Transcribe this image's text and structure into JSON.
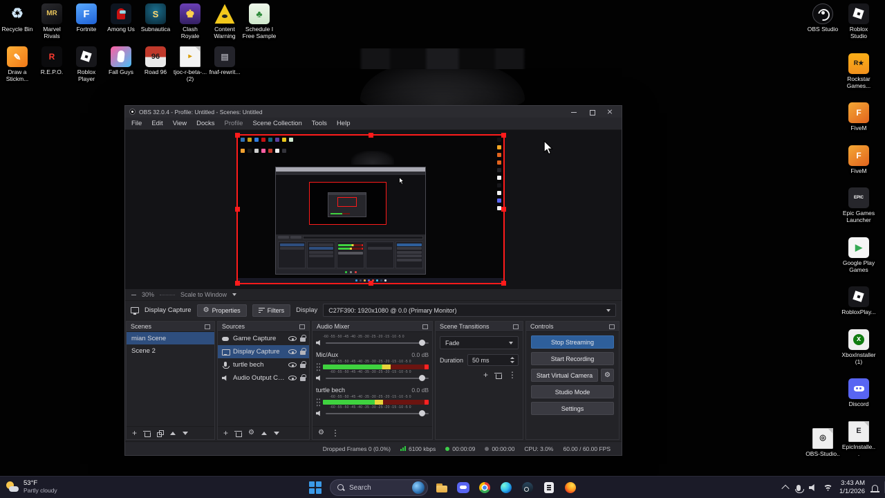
{
  "colors": {
    "selection_blue": "#2e4e7e",
    "active_button_blue": "#2e5f9b",
    "capture_border_red": "#ff1b1b",
    "meter_green": "#3fd23f",
    "meter_yellow": "#e8d43a",
    "meter_red_dim": "#6b1410",
    "meter_clip_red": "#ff2222"
  },
  "glyphs": {
    "gear": "⚙",
    "plus": "+",
    "kebab": "⋮"
  },
  "desktop": {
    "row1": [
      {
        "label": "Recycle Bin",
        "glyph": "♻",
        "fg": "#cfe6f7",
        "gs": 20,
        "bg": "transparent"
      },
      {
        "label": "Marvel Rivals",
        "glyph": "MR",
        "fg": "#e7c35a",
        "gs": 10,
        "bg": "linear-gradient(145deg,#2a2a2e,#0e0e10)"
      },
      {
        "label": "Fortnite",
        "glyph": "F",
        "fg": "#ffffff",
        "gs": 15,
        "bg": "linear-gradient(160deg,#58a8ff,#1f62d6)"
      },
      {
        "label": "Among Us",
        "shape": "crewmate",
        "bg": "#0d1520"
      },
      {
        "label": "Subnautica",
        "glyph": "S",
        "fg": "#ffd76e",
        "gs": 13,
        "bg": "radial-gradient(circle at 50% 35%,#1a6d8c,#0a2836)"
      },
      {
        "label": "Clash Royale",
        "glyph": "♚",
        "fg": "#ffd24d",
        "gs": 15,
        "bg": "linear-gradient(#6a3fb5,#342063)"
      },
      {
        "label": "Content Warning",
        "shape": "warning",
        "bg": "#f2c81c"
      },
      {
        "label": "Schedule I Free Sample",
        "glyph": "♣",
        "fg": "#2e8b3a",
        "gs": 14,
        "bg": "linear-gradient(#eef7ea,#cfe8cc)"
      }
    ],
    "row2": [
      {
        "label": "Draw a Stickm...",
        "glyph": "✎",
        "fg": "#ffffff",
        "gs": 13,
        "bg": "linear-gradient(135deg,#ffb037,#f07818)"
      },
      {
        "label": "R.E.P.O.",
        "glyph": "R",
        "fg": "#ff3b30",
        "gs": 12,
        "bg": "#0b0b0d"
      },
      {
        "label": "Roblox Player",
        "shape": "roblox",
        "bg": "#17171b"
      },
      {
        "label": "Fall Guys",
        "shape": "bean",
        "bg": "linear-gradient(135deg,#ff5fa2,#49c0f8)"
      },
      {
        "label": "Road 96",
        "glyph": "96",
        "fg": "#1c1c1c",
        "gs": 11,
        "bg": "linear-gradient(#c0392b 0 52%,#e9e9e9 52% 100%)"
      },
      {
        "label": "tjoc-r-beta-... (2)",
        "shape": "page",
        "glyph": "▸",
        "fg": "#d79b00",
        "gs": 10,
        "bg": "#f4f4f4"
      },
      {
        "label": "fnaf-rewrit...",
        "glyph": "▤",
        "fg": "#9a9aa2",
        "gs": 12,
        "bg": "#23232a"
      }
    ],
    "right_col_a": [
      {
        "label": "OBS Studio",
        "shape": "obs",
        "bg": "#0c0c0e",
        "round": true
      },
      {
        "label": "OBS-Studio..",
        "shape": "page",
        "glyph": "◎",
        "fg": "#222222",
        "gs": 11,
        "bg": "#efefef"
      }
    ],
    "right_col_b": [
      {
        "label": "Roblox Studio",
        "shape": "roblox",
        "bg": "#17171b"
      },
      {
        "label": "Rockstar Games...",
        "glyph": "R★",
        "fg": "#151515",
        "gs": 9,
        "bg": "linear-gradient(#fcaf17,#f2921d)"
      },
      {
        "label": "FiveM",
        "glyph": "F",
        "fg": "#ffffff",
        "gs": 12,
        "bg": "linear-gradient(145deg,#f4a835,#e2641e)"
      },
      {
        "label": "FiveM",
        "glyph": "F",
        "fg": "#ffffff",
        "gs": 12,
        "bg": "linear-gradient(145deg,#f4a835,#e2641e)"
      },
      {
        "label": "Epic Games Launcher",
        "glyph": "EPIC",
        "fg": "#ffffff",
        "gs": 6,
        "bg": "#26262b"
      },
      {
        "label": "Google Play Games",
        "glyph": "▶",
        "fg": "#34a853",
        "gs": 13,
        "bg": "#f5f5f5"
      },
      {
        "label": "RobloxPlay...",
        "shape": "roblox",
        "bg": "#17171b"
      },
      {
        "label": "XboxInstaller (1)",
        "shape": "xbox",
        "glyph": "x",
        "fg": "#ffffff",
        "gs": 11,
        "bg": "#f0f0f0"
      },
      {
        "label": "Discord",
        "shape": "discord",
        "bg": "#5865F2"
      },
      {
        "label": "EpicInstalle...",
        "shape": "page",
        "glyph": "E",
        "fg": "#26262b",
        "gs": 11,
        "bg": "#efefef"
      }
    ]
  },
  "obs": {
    "title": "OBS 32.0.4 - Profile: Untitled - Scenes: Untitled",
    "menu": [
      {
        "label": "File"
      },
      {
        "label": "Edit"
      },
      {
        "label": "View"
      },
      {
        "label": "Docks"
      },
      {
        "label": "Profile",
        "dim": true
      },
      {
        "label": "Scene Collection"
      },
      {
        "label": "Tools"
      },
      {
        "label": "Help"
      }
    ],
    "preview": {
      "zoom": "30%",
      "scale_mode": "Scale to Window"
    },
    "context": {
      "source": "Display Capture",
      "properties": "Properties",
      "filters": "Filters",
      "display_label": "Display",
      "display_value": "C27F390: 1920x1080 @ 0.0 (Primary Monitor)"
    },
    "scenes": {
      "title": "Scenes",
      "items": [
        {
          "name": "mian Scene",
          "selected": true
        },
        {
          "name": "Scene 2"
        }
      ]
    },
    "sources": {
      "title": "Sources",
      "items": [
        {
          "name": "Game Capture",
          "type": "game"
        },
        {
          "name": "Display Capture",
          "type": "display",
          "selected": true
        },
        {
          "name": "turtle bech",
          "type": "mic"
        },
        {
          "name": "Audio Output Cap...",
          "type": "speaker"
        }
      ]
    },
    "mixer": {
      "title": "Audio Mixer",
      "scale": "-60 -55 -50 -45 -40 -35 -30 -25 -20 -15 -10 -5 0",
      "channels": [
        {
          "name": "Mic/Aux",
          "db": "0.0 dB",
          "fill": 0.64
        },
        {
          "name": "turtle bech",
          "db": "0.0 dB",
          "fill": 0.57
        }
      ]
    },
    "transitions": {
      "title": "Scene Transitions",
      "transition": "Fade",
      "duration_label": "Duration",
      "duration_value": "50 ms"
    },
    "controls": {
      "title": "Controls",
      "buttons": [
        {
          "label": "Stop Streaming",
          "active": true
        },
        {
          "label": "Start Recording"
        },
        {
          "label": "Start Virtual Camera",
          "gear": true
        },
        {
          "label": "Studio Mode"
        },
        {
          "label": "Settings"
        }
      ]
    },
    "status": {
      "dropped": "Dropped Frames 0 (0.0%)",
      "bitrate": "6100 kbps",
      "stream_time": "00:00:09",
      "rec_time": "00:00:00",
      "cpu": "CPU: 3.0%",
      "fps": "60.00 / 60.00 FPS"
    }
  },
  "taskbar": {
    "weather": {
      "temp": "53°F",
      "desc": "Partly cloudy"
    },
    "search_placeholder": "Search",
    "icons": [
      "folder",
      "discord",
      "chrome",
      "edge",
      "steam",
      "epic",
      "firefox"
    ],
    "time": "3:43 AM",
    "date": "1/1/2026"
  }
}
